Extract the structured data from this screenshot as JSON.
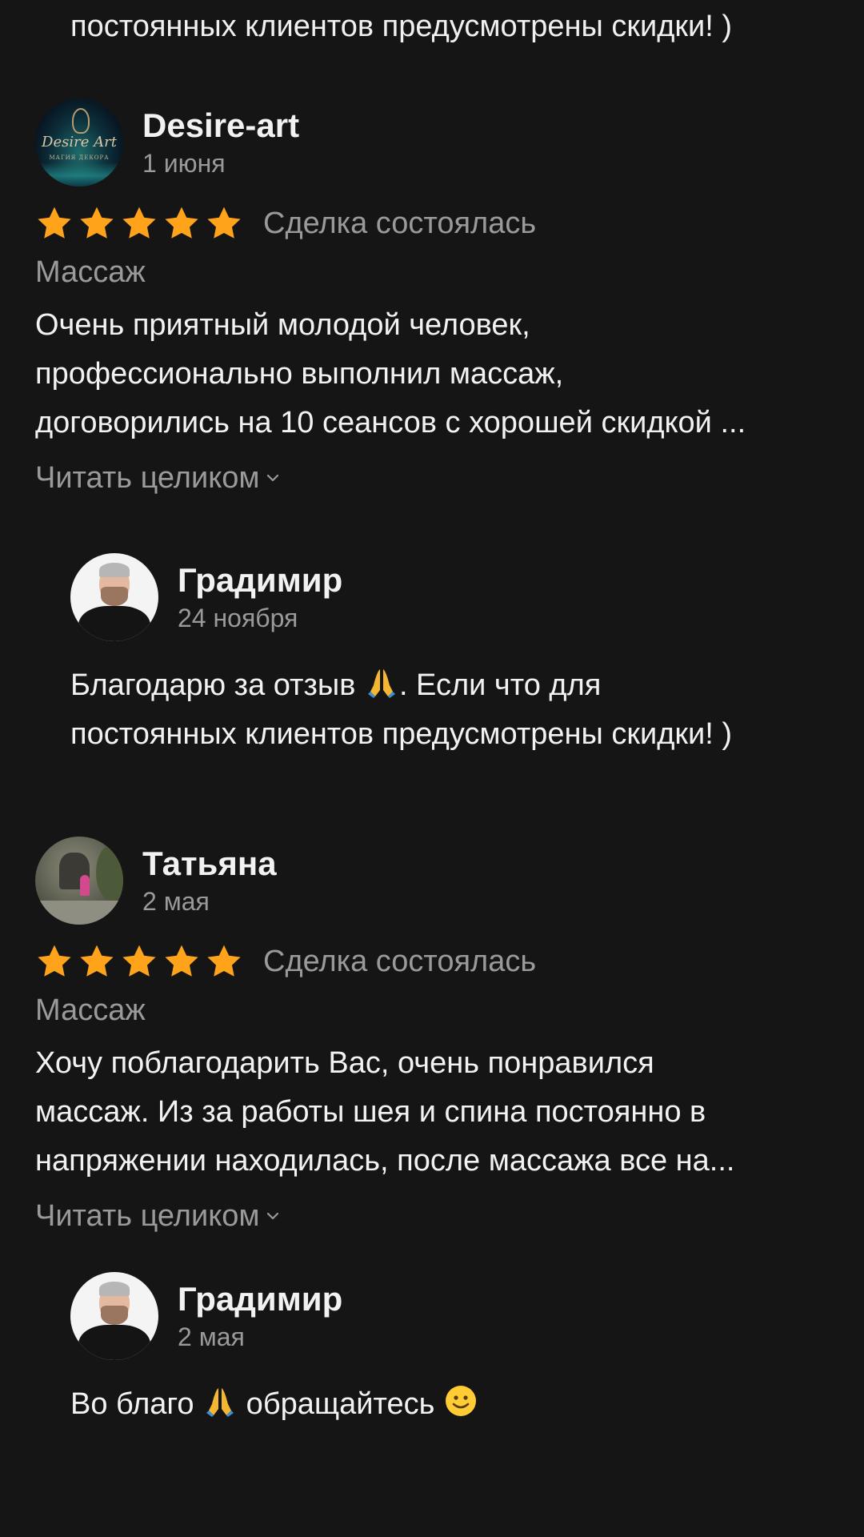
{
  "top_reply_tail": "постоянных клиентов предусмотрены скидки! )",
  "reviews": [
    {
      "author": "Desire-art",
      "avatar_text": "Desire Art",
      "avatar_subtext": "МАГИЯ ДЕКОРА",
      "date": "1 июня",
      "rating": 5,
      "deal_status": "Сделка состоялась",
      "category": "Массаж",
      "text": "Очень приятный молодой человек,\nпрофессионально выполнил массаж,\nдоговорились на 10 сеансов с хорошей скидкой ...",
      "read_more": "Читать целиком",
      "reply": {
        "author": "Градимир",
        "date": "24 ноября",
        "text_part1": "Благодарю за отзыв ",
        "text_part2": ". Если что для\nпостоянных клиентов предусмотрены скидки! )"
      }
    },
    {
      "author": "Татьяна",
      "date": "2 мая",
      "rating": 5,
      "deal_status": "Сделка состоялась",
      "category": "Массаж",
      "text": "Хочу поблагодарить Вас, очень понравился\nмассаж. Из за  работы шея и спина постоянно в\nнапряжении находилась, после массажа все на...",
      "read_more": "Читать целиком",
      "reply": {
        "author": "Градимир",
        "date": "2 мая",
        "text_part1": "Во благо ",
        "text_part2": " обращайтесь "
      }
    }
  ],
  "icons": {
    "star": "star-icon",
    "chevron": "chevron-down-icon",
    "pray_emoji": "folded-hands-emoji",
    "smile_emoji": "slightly-smiling-face-emoji"
  },
  "colors": {
    "background": "#151515",
    "star": "#FFA31A",
    "muted_text": "#9a9a9a",
    "primary_text": "#f2f2f2"
  }
}
